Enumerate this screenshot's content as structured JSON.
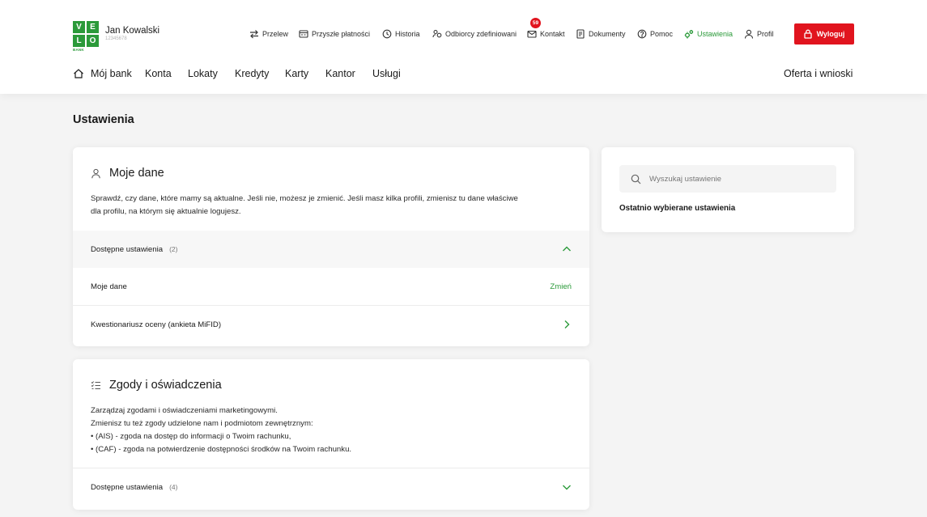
{
  "brand": {
    "logo_letters": [
      "V",
      "E",
      "L",
      "O"
    ],
    "logo_sub": "BANK",
    "color": "#2b9a3a"
  },
  "user": {
    "name": "Jan Kowalski",
    "id": "12345678"
  },
  "topnav": [
    {
      "label": "Przelew",
      "icon": "transfer-icon"
    },
    {
      "label": "Przyszłe płatności",
      "icon": "calendar-icon"
    },
    {
      "label": "Historia",
      "icon": "history-icon"
    },
    {
      "label": "Odbiorcy zdefiniowani",
      "icon": "recipients-icon"
    },
    {
      "label": "Kontakt",
      "icon": "mail-icon",
      "badge": "59"
    },
    {
      "label": "Dokumenty",
      "icon": "document-icon"
    },
    {
      "label": "Pomoc",
      "icon": "help-icon"
    },
    {
      "label": "Ustawienia",
      "icon": "gears-icon",
      "active": true
    },
    {
      "label": "Profil",
      "icon": "user-icon"
    }
  ],
  "logout": {
    "label": "Wyloguj",
    "color": "#e1141e"
  },
  "mainnav": [
    {
      "label": "Mój bank",
      "icon": "home-icon"
    },
    {
      "label": "Konta"
    },
    {
      "label": "Lokaty"
    },
    {
      "label": "Kredyty"
    },
    {
      "label": "Karty"
    },
    {
      "label": "Kantor"
    },
    {
      "label": "Usługi"
    }
  ],
  "mainnav_right": "Oferta i wnioski",
  "page": {
    "title": "Ustawienia"
  },
  "card_moje_dane": {
    "title": "Moje dane",
    "desc": [
      "Sprawdź, czy dane, które mamy są aktualne. Jeśli nie, możesz je zmienić. Jeśli masz kilka profili, zmienisz tu dane właściwe",
      "dla profilu, na którym się aktualnie logujesz."
    ],
    "available_label": "Dostępne ustawienia",
    "available_count": "(2)",
    "rows": [
      {
        "label": "Moje dane",
        "action": "Zmień"
      },
      {
        "label": "Kwestionariusz oceny (ankieta MiFID)"
      }
    ]
  },
  "card_zgody": {
    "title": "Zgody i oświadczenia",
    "desc": [
      "Zarządzaj zgodami i oświadczeniami marketingowymi.",
      "Zmienisz tu też zgody udzielone nam i podmiotom zewnętrznym:",
      "• (AIS) - zgoda na dostęp do informacji o Twoim rachunku,",
      "• (CAF) - zgoda na potwierdzenie dostępności środków na Twoim rachunku."
    ],
    "available_label": "Dostępne ustawienia",
    "available_count": "(4)"
  },
  "sidebar": {
    "search_placeholder": "Wyszukaj ustawienie",
    "recent_title": "Ostatnio wybierane ustawienia"
  }
}
